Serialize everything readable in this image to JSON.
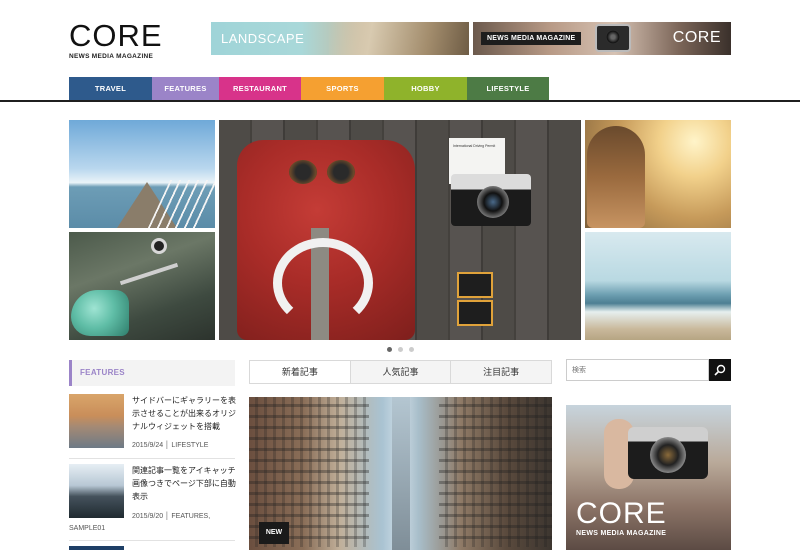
{
  "logo": {
    "title": "CORE",
    "subtitle": "NEWS MEDIA MAGAZINE"
  },
  "banners": {
    "landscape": "LANDSCAPE",
    "core_tag": "NEWS MEDIA MAGAZINE",
    "core_title": "CORE"
  },
  "nav": [
    {
      "label": "TRAVEL",
      "color": "#2e5a8c"
    },
    {
      "label": "FEATURES",
      "color": "#9b84c8"
    },
    {
      "label": "RESTAURANT",
      "color": "#d8338a"
    },
    {
      "label": "SPORTS",
      "color": "#f5a031"
    },
    {
      "label": "HOBBY",
      "color": "#8fb32b"
    },
    {
      "label": "LIFESTYLE",
      "color": "#4d7b45"
    }
  ],
  "hero": {
    "paper_text": "International Driving Permit",
    "slides": 3,
    "active_slide": 0
  },
  "features": {
    "heading": "FEATURES",
    "posts": [
      {
        "title": "サイドバーにギャラリーを表示させることが出来るオリジナルウィジェットを搭載",
        "meta": "2015/9/24 │ LIFESTYLE"
      },
      {
        "title": "関連記事一覧をアイキャッチ画像つきでページ下部に自動表示",
        "meta": "2015/9/20 │ FEATURES,",
        "meta2": "SAMPLE01"
      }
    ]
  },
  "tabs": [
    "新着記事",
    "人気記事",
    "注目記事"
  ],
  "new_badge": "NEW",
  "search": {
    "placeholder": "検索"
  },
  "ad": {
    "title": "CORE",
    "subtitle": "NEWS MEDIA MAGAZINE"
  },
  "icons": {
    "search_button": "search-icon"
  }
}
